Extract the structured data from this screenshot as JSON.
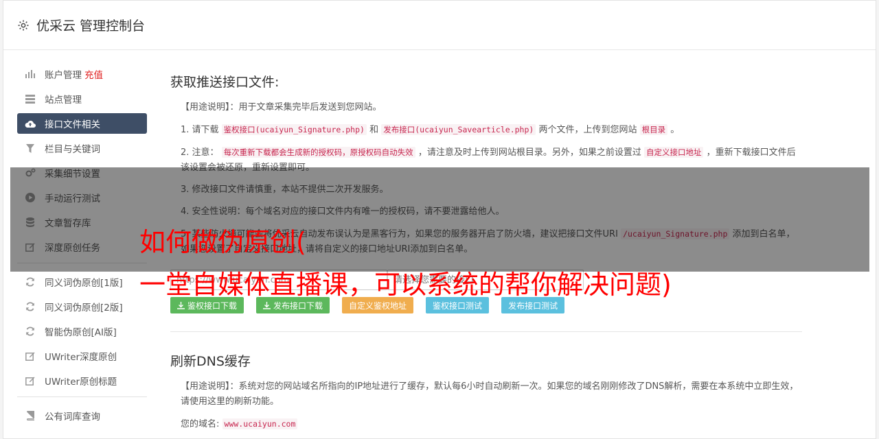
{
  "app_title": "优采云 管理控制台",
  "sidebar": {
    "group1": [
      {
        "label": "账户管理",
        "extra": "充值",
        "icon": "bar-chart-icon"
      },
      {
        "label": "站点管理",
        "icon": "server-icon"
      },
      {
        "label": "接口文件相关",
        "icon": "cloud-upload-icon",
        "active": true
      },
      {
        "label": "栏目与关键词",
        "icon": "filter-icon"
      },
      {
        "label": "采集细节设置",
        "icon": "cogs-icon"
      },
      {
        "label": "手动运行测试",
        "icon": "play-icon"
      },
      {
        "label": "文章暂存库",
        "icon": "database-icon"
      },
      {
        "label": "深度原创任务",
        "icon": "edit-icon"
      }
    ],
    "group2": [
      {
        "label": "同义词伪原创[1版]",
        "icon": "refresh-icon"
      },
      {
        "label": "同义词伪原创[2版]",
        "icon": "refresh-icon"
      },
      {
        "label": "智能伪原创[AI版]",
        "icon": "refresh-icon"
      },
      {
        "label": "UWriter深度原创",
        "icon": "edit-icon"
      },
      {
        "label": "UWriter原创标题",
        "icon": "edit-icon"
      }
    ],
    "group3": [
      {
        "label": "公有词库查询",
        "icon": "book-icon"
      }
    ]
  },
  "section1": {
    "title": "获取推送接口文件:",
    "usage": "【用途说明】：用于文章采集完毕后发送到您网站。",
    "step1_a": "1. 请下载",
    "step1_code1": "鉴权接口(ucaiyun_Signature.php)",
    "step1_b": "和",
    "step1_code2": "发布接口(ucaiyun_Savearticle.php)",
    "step1_c": "两个文件，上传到您网站",
    "step1_code3": "根目录",
    "step1_d": "。",
    "step2_a": "2. 注意：",
    "step2_code1": "每次重新下载都会生成新的授权码，原授权码自动失效",
    "step2_b": "，请注意及时上传到网站根目录。另外，如果之前设置过",
    "step2_code2": "自定义接口地址",
    "step2_c": "，重新下载接口文件后该设置会被还原，重新设置即可。",
    "step3": "3. 修改接口文件请慎重，本站不提供二次开发服务。",
    "step4": "4. 安全性说明：每个域名对应的接口文件内有唯一的授权码，请不要泄露给他人。",
    "step5_a": "5. 某些防火墙可能会将优采云自动发布误认为是黑客行为，如果您的服务器开启了防火墙，建议把接口文件URI",
    "step5_code": "/ucaiyun_Signature.php",
    "step5_b": "添加到白名单，如果您设置了自定义接口地址，请将自定义的接口地址URI添加到白名单。",
    "input1_value": "https://www.ucaiyun.com",
    "input2_placeholder": "请选择您需要的接口",
    "buttons": {
      "download_sig": "鉴权接口下载",
      "download_pub": "发布接口下载",
      "custom_auth": "自定义鉴权地址",
      "test_sig": "鉴权接口测试",
      "test_pub": "发布接口测试"
    }
  },
  "section2": {
    "title": "刷新DNS缓存",
    "usage": "【用途说明】：系统对您的网站域名所指向的IP地址进行了缓存，默认每6小时自动刷新一次。如果您的域名刚刚修改了DNS解析，需要在本系统中立即生效，请使用这里的刷新功能。",
    "domain_label": "您的域名:",
    "domain_value": "www.ucaiyun.com"
  },
  "overlay": {
    "line1": "如何做伪原创(",
    "line2": "一堂自媒体直播课，可以系统的帮你解决问题)"
  }
}
